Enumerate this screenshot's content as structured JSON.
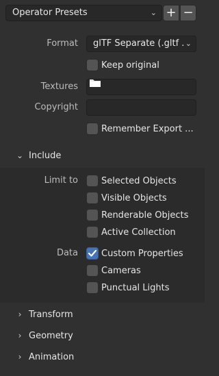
{
  "presets": {
    "label": "Operator Presets",
    "add": "+",
    "remove": "−",
    "dropdown_icon": "chevron-down-icon"
  },
  "format": {
    "label": "Format",
    "value": "glTF Separate (.gltf ..."
  },
  "keep_original": {
    "label": "Keep original",
    "checked": false
  },
  "textures": {
    "label": "Textures",
    "value": "",
    "icon": "folder-icon"
  },
  "copyright": {
    "label": "Copyright",
    "value": ""
  },
  "remember_export": {
    "label": "Remember Export ...",
    "checked": false
  },
  "include": {
    "title": "Include",
    "expanded": true,
    "limit_to_label": "Limit to",
    "limit_to": [
      {
        "label": "Selected Objects",
        "checked": false
      },
      {
        "label": "Visible Objects",
        "checked": false
      },
      {
        "label": "Renderable Objects",
        "checked": false
      },
      {
        "label": "Active Collection",
        "checked": false
      }
    ],
    "data_label": "Data",
    "data": [
      {
        "label": "Custom Properties",
        "checked": true
      },
      {
        "label": "Cameras",
        "checked": false
      },
      {
        "label": "Punctual Lights",
        "checked": false
      }
    ]
  },
  "panels": [
    {
      "title": "Transform",
      "expanded": false
    },
    {
      "title": "Geometry",
      "expanded": false
    },
    {
      "title": "Animation",
      "expanded": false
    }
  ]
}
